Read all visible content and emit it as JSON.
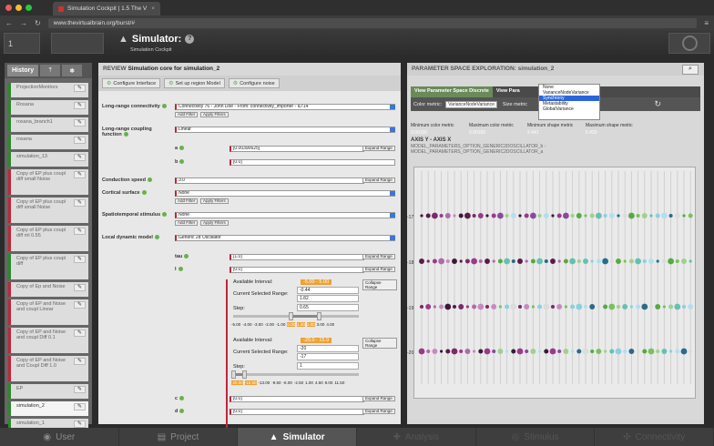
{
  "browser": {
    "tab_title": "Simulation Cockpit | 1.5 The V",
    "url": "www.thevirtualbrain.org/burst/#",
    "colors": {
      "close": "#ee5f57",
      "min": "#f8bd2e",
      "max": "#28c840"
    }
  },
  "header": {
    "title": "Simulator:",
    "subtitle": "Simulation Cockpit",
    "project_num": "1"
  },
  "sidebar": {
    "tab_label": "History",
    "items": [
      {
        "label": "ProjectionMonitors",
        "color": "green"
      },
      {
        "label": "Rosana",
        "color": "green"
      },
      {
        "label": "rosana_branch1",
        "color": "green"
      },
      {
        "label": "rosana",
        "color": "green"
      },
      {
        "label": "simulation_13",
        "color": "green"
      },
      {
        "label": "Copy of EP plus coupl diff small Noise",
        "color": "red"
      },
      {
        "label": "Copy of EP plus coupl diff small Noise",
        "color": "red"
      },
      {
        "label": "Copy of EP plus coupl diff ml 0.55",
        "color": "red"
      },
      {
        "label": "Copy of EP plus coupl diff",
        "color": "green"
      },
      {
        "label": "Copy of Ep and Noise",
        "color": "red"
      },
      {
        "label": "Copy of EP and Noise and coupl Linear",
        "color": "red"
      },
      {
        "label": "Copy of EP and Noise and coupl Diff 0.1",
        "color": "red"
      },
      {
        "label": "Copy of EP and Noise and Coupl Diff 1.0",
        "color": "red"
      },
      {
        "label": "EP",
        "color": "green"
      },
      {
        "label": "simulation_2",
        "color": "green"
      },
      {
        "label": "simulation_1",
        "color": "green"
      }
    ]
  },
  "middle": {
    "review_prefix": "REVIEW",
    "title": "Simulation core for simulation_2",
    "toolbar": [
      "Configure Interface",
      "Set up region Model",
      "Configure noise"
    ],
    "fields": [
      {
        "label": "Long-range connectivity",
        "value": "Connectivity 76 - John Doe - From: connectivity_importer - ID:14",
        "type": "select"
      },
      {
        "label": "Long-range coupling function",
        "value": "Linear",
        "type": "select"
      },
      {
        "label": "a",
        "value": "[0.00390625]",
        "type": "text"
      },
      {
        "label": "b",
        "value": "[0.0]",
        "type": "text"
      },
      {
        "label": "Conduction speed",
        "value": "3.0",
        "type": "text"
      },
      {
        "label": "Cortical surface",
        "value": "None",
        "type": "select"
      },
      {
        "label": "Spatiotemporal stimulus",
        "value": "None",
        "type": "select"
      },
      {
        "label": "Local dynamic model",
        "value": "Generic 2d Oscillator",
        "type": "select"
      },
      {
        "label": "tau",
        "value": "[1.0]",
        "type": "text"
      },
      {
        "label": "I",
        "value": "[0.0]",
        "type": "text"
      },
      {
        "label": "c",
        "value": "[0.0]",
        "type": "text"
      },
      {
        "label": "d",
        "value": "[0.0]",
        "type": "text"
      }
    ],
    "add_filter": "Add Filter",
    "apply_filters": "Apply Filters",
    "expand_range": "Expand Range",
    "collapse_range": "Collapse Range",
    "range_a": {
      "available": "Available Interval:",
      "interval": "-5.00 - 5.00",
      "current": "Current Selected Range:",
      "lo": "-0.44",
      "hi": "1.82",
      "step_label": "Step:",
      "step": "0.65",
      "ticks": [
        "-5.00",
        "-4.00",
        "-3.00",
        "-2.00",
        "-1.00",
        "0.00",
        "1.00",
        "2.00",
        "3.00",
        "4.00"
      ]
    },
    "range_b": {
      "available": "Available Interval:",
      "interval": "-20.0 - 15.0",
      "current": "Current Selected Range:",
      "lo": "-20",
      "hi": "-17",
      "step_label": "Step:",
      "step": "1",
      "ticks": [
        "-20.00",
        "-16.50",
        "-13.00",
        "-9.50",
        "-6.00",
        "-2.50",
        "1.00",
        "4.50",
        "8.00",
        "11.50"
      ]
    }
  },
  "right": {
    "title": "PARAMETER SPACE EXPLORATION: simulation_2",
    "tabs": [
      "View Parameter Space Discrete",
      "View Para"
    ],
    "color_metric_label": "Color metric:",
    "color_metric": "VarianceNodeVariance",
    "size_metric_label": "Size metric",
    "dropdown": [
      "None",
      "VarianceNodeVariance",
      "Synchrony",
      "Metastability",
      "GlobalVariance"
    ],
    "dropdown_selected": "Synchrony",
    "metric_heads": [
      "Minimum color metric",
      "Maximum color metric",
      "Minimum shape metric",
      "Maximum shape metric"
    ],
    "metric_vals": [
      "0.00100",
      "0.00100",
      "2.441",
      "5.420"
    ],
    "axis_y": "AXIS Y - AXIS X",
    "axis_line1": "MODEL_PARAMETERS_OPTION_GENERIC2DOSCILLATOR_b -",
    "axis_line2": "MODEL_PARAMETERS_OPTION_GENERIC2DOSCILLATOR_a",
    "y_ticks": [
      "-17",
      "-18",
      "-19",
      "-20"
    ]
  },
  "nav": [
    "User",
    "Project",
    "Simulator",
    "Analysis",
    "Stimulus",
    "Connectivity"
  ],
  "nav_active": "Simulator"
}
